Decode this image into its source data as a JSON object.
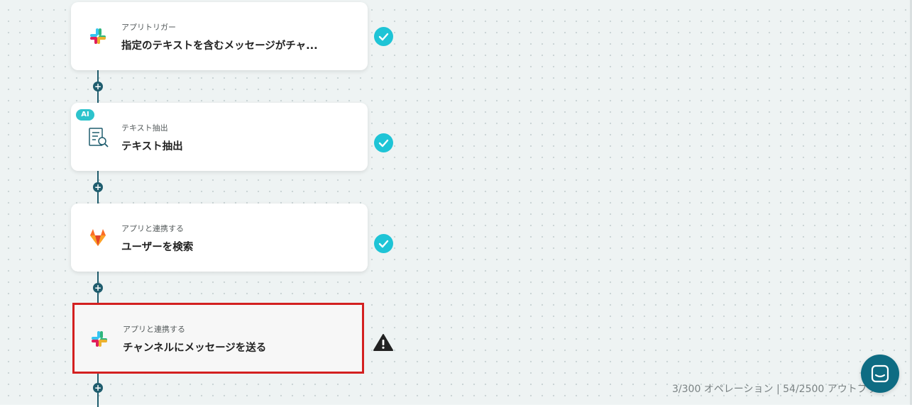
{
  "flow": {
    "steps": [
      {
        "type_label": "アプリトリガー",
        "title": "指定のテキストを含むメッセージがチャ...",
        "app_icon": "slack-icon",
        "status": "completed"
      },
      {
        "type_label": "テキスト抽出",
        "title": "テキスト抽出",
        "app_icon": "document-search-icon",
        "badge": "AI",
        "status": "completed"
      },
      {
        "type_label": "アプリと連携する",
        "title": "ユーザーを検索",
        "app_icon": "gitlab-icon",
        "status": "completed"
      },
      {
        "type_label": "アプリと連携する",
        "title": "チャンネルにメッセージを送る",
        "app_icon": "slack-icon",
        "status": "warning",
        "selected": true
      }
    ],
    "add_step_symbol": "+"
  },
  "footer": {
    "usage": "3/300 オペレーション | 54/2500 アウトプット"
  },
  "colors": {
    "connector": "#1f5d6e",
    "status_completed": "#1ec4d6",
    "selected_border": "#d32020",
    "ai_badge": "#2cc3cc",
    "chat_button": "#0e6c83"
  }
}
